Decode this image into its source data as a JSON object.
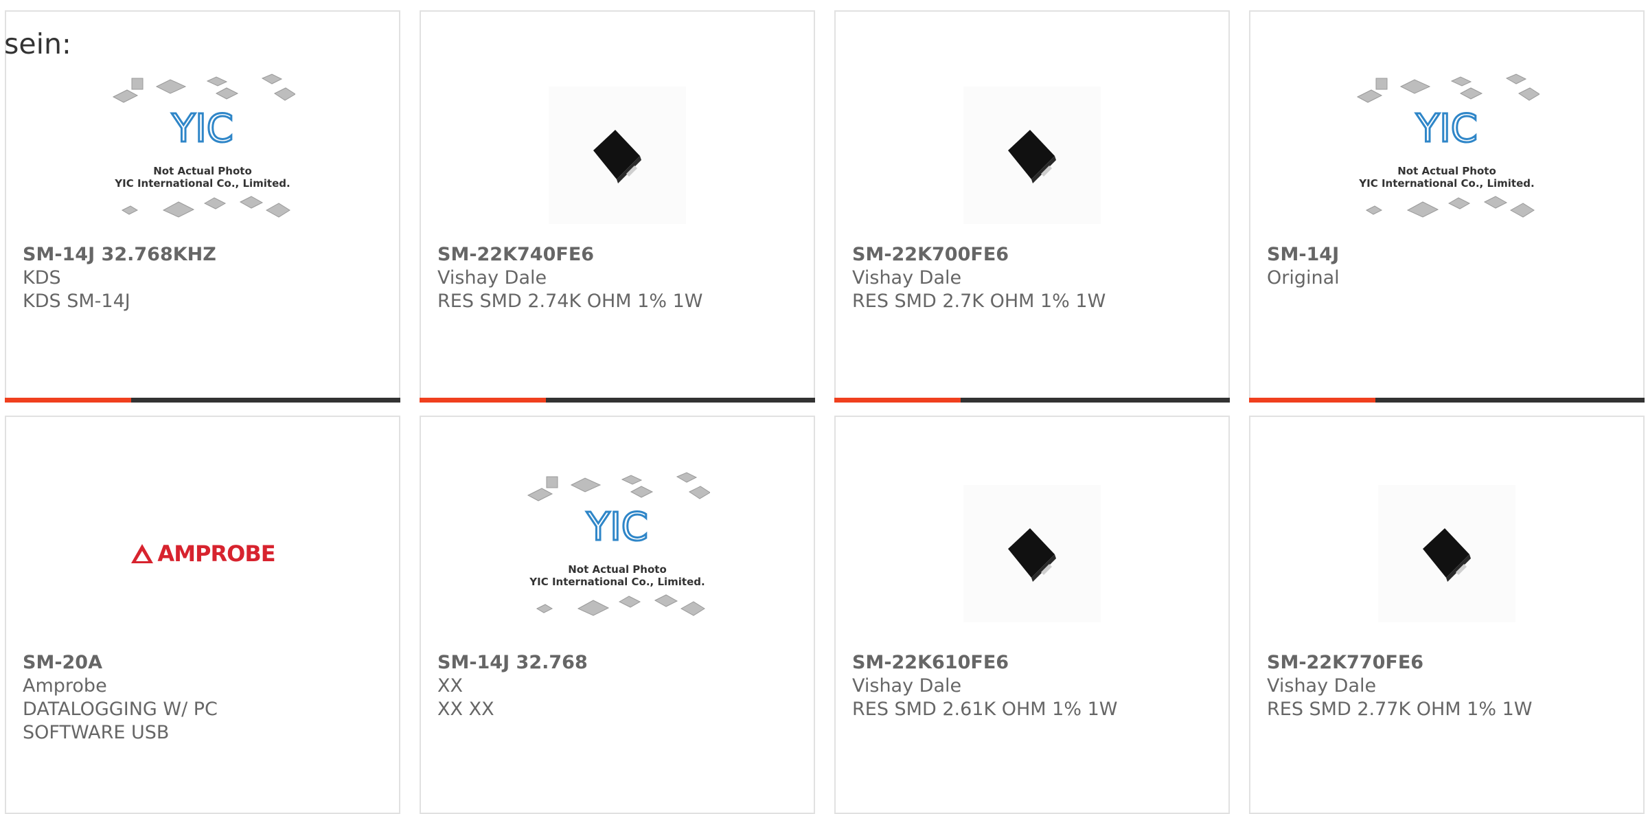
{
  "intro_text": "sein:",
  "colors": {
    "accent": "#f0401e",
    "bar_dark": "#333333",
    "border": "#e1e1e1",
    "text": "#666666"
  },
  "placeholder": {
    "line1": "Not Actual Photo",
    "line2": "YIC International Co., Limited.",
    "logo": "YIC"
  },
  "amprobe_logo": "AMPROBE",
  "products": [
    {
      "part": "SM-14J 32.768KHZ",
      "maker": "KDS",
      "desc": "KDS SM-14J",
      "image": "yic-placeholder"
    },
    {
      "part": "SM-22K740FE6",
      "maker": "Vishay Dale",
      "desc": "RES SMD 2.74K OHM 1% 1W",
      "image": "smd-resistor"
    },
    {
      "part": "SM-22K700FE6",
      "maker": "Vishay Dale",
      "desc": "RES SMD 2.7K OHM 1% 1W",
      "image": "smd-resistor"
    },
    {
      "part": "SM-14J",
      "maker": "Original",
      "desc": "",
      "image": "yic-placeholder"
    },
    {
      "part": "SM-20A",
      "maker": "Amprobe",
      "desc": "DATALOGGING W/ PC SOFTWARE USB",
      "image": "amprobe-logo"
    },
    {
      "part": "SM-14J 32.768",
      "maker": "XX",
      "desc": "XX XX",
      "image": "yic-placeholder"
    },
    {
      "part": "SM-22K610FE6",
      "maker": "Vishay Dale",
      "desc": "RES SMD 2.61K OHM 1% 1W",
      "image": "smd-resistor"
    },
    {
      "part": "SM-22K770FE6",
      "maker": "Vishay Dale",
      "desc": "RES SMD 2.77K OHM 1% 1W",
      "image": "smd-resistor"
    }
  ]
}
